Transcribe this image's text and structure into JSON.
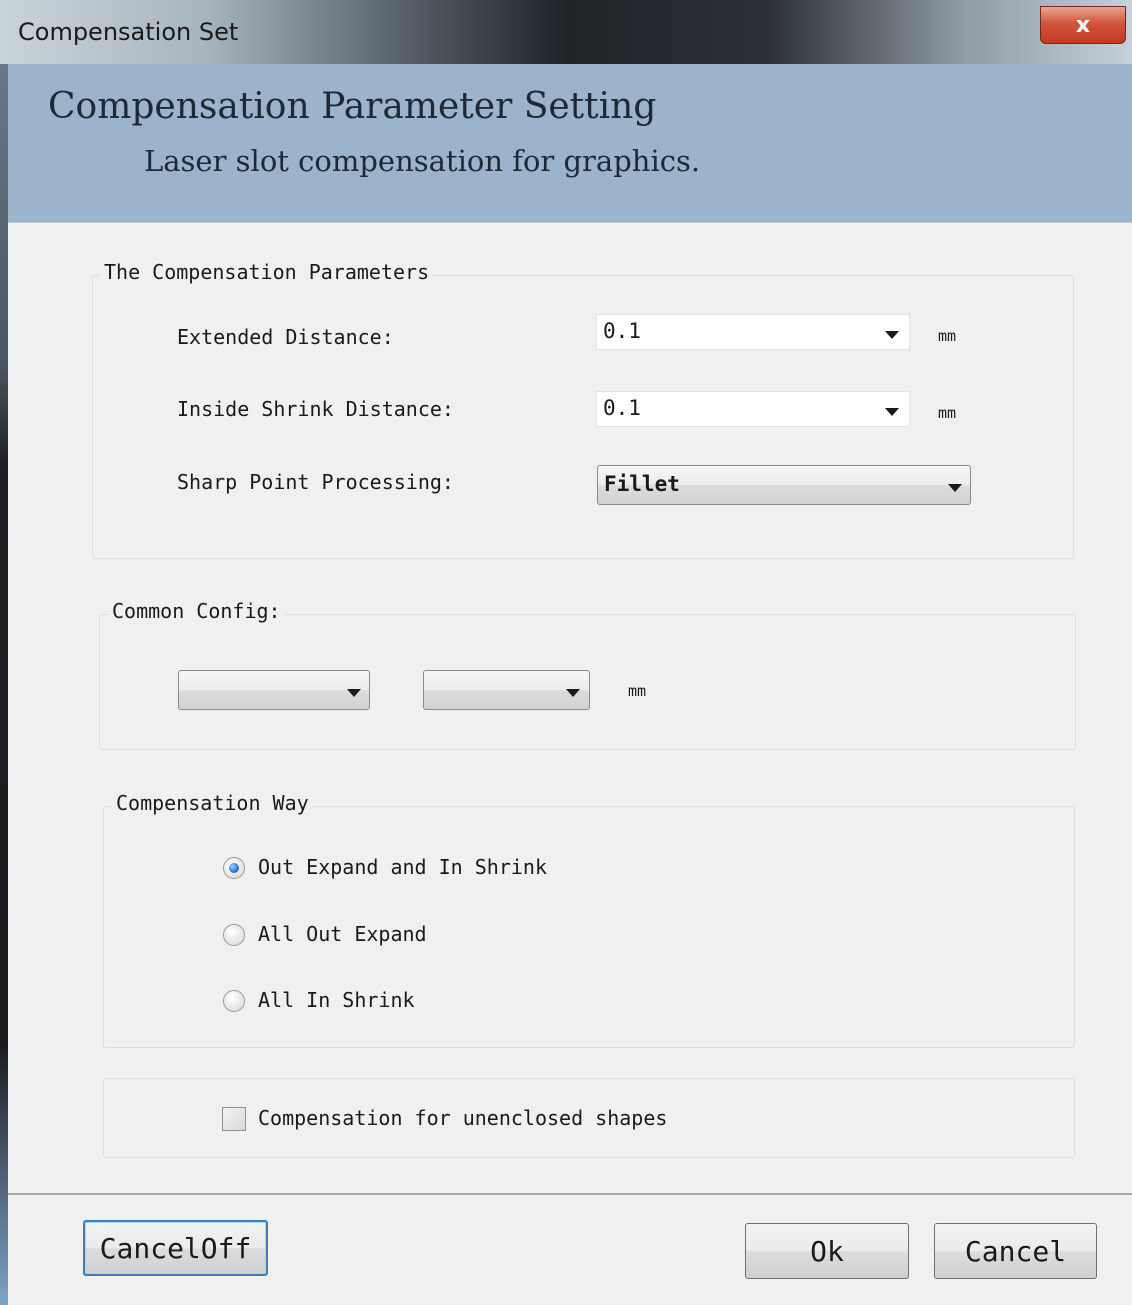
{
  "window": {
    "title": "Compensation Set",
    "close_label": "x"
  },
  "header": {
    "title": "Compensation Parameter Setting",
    "subtitle": "Laser slot compensation for graphics."
  },
  "compensation_parameters": {
    "group_label": "The Compensation Parameters",
    "extended_distance": {
      "label": "Extended Distance:",
      "value": "0.1",
      "unit": "mm"
    },
    "inside_shrink_distance": {
      "label": "Inside Shrink Distance:",
      "value": "0.1",
      "unit": "mm"
    },
    "sharp_point_processing": {
      "label": "Sharp Point Processing:",
      "value": "Fillet"
    }
  },
  "common_config": {
    "group_label": "Common Config:",
    "combo1_value": "",
    "combo2_value": "",
    "unit": "mm"
  },
  "compensation_way": {
    "group_label": "Compensation Way",
    "options": [
      {
        "label": "Out Expand and In Shrink",
        "checked": true
      },
      {
        "label": "All Out Expand",
        "checked": false
      },
      {
        "label": "All In Shrink",
        "checked": false
      }
    ]
  },
  "unenclosed": {
    "label": "Compensation for unenclosed shapes",
    "checked": false
  },
  "buttons": {
    "cancel_off": "CancelOff",
    "ok": "Ok",
    "cancel": "Cancel"
  }
}
